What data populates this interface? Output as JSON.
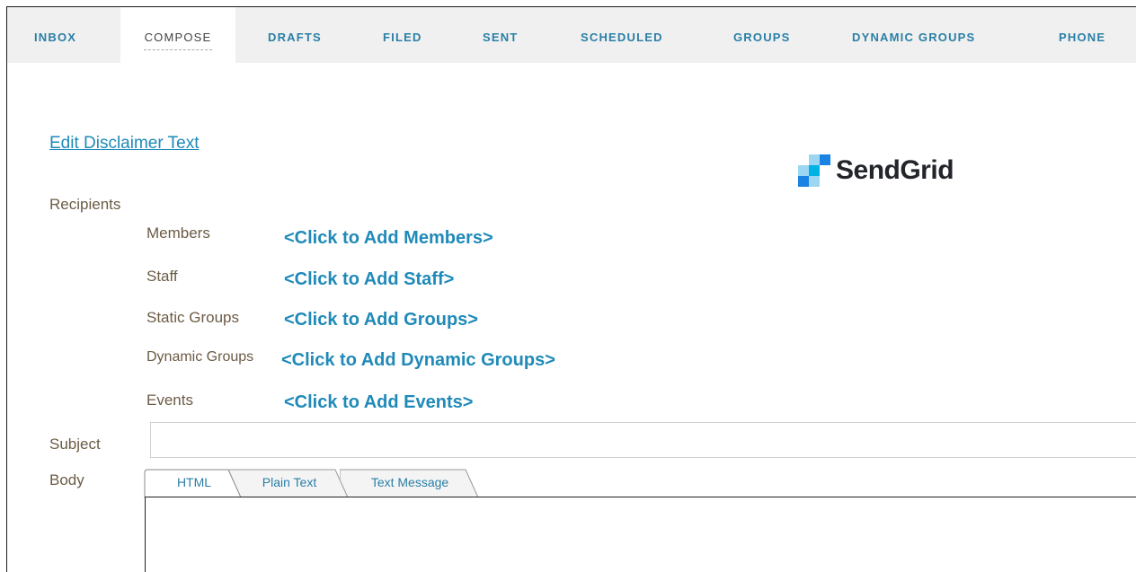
{
  "nav": {
    "items": [
      {
        "label": "INBOX"
      },
      {
        "label": "COMPOSE",
        "active": true
      },
      {
        "label": "DRAFTS"
      },
      {
        "label": "FILED"
      },
      {
        "label": "SENT"
      },
      {
        "label": "SCHEDULED"
      },
      {
        "label": "GROUPS"
      },
      {
        "label": "DYNAMIC GROUPS"
      },
      {
        "label": "PHONE"
      }
    ]
  },
  "compose": {
    "disclaimer_link": "Edit Disclaimer Text",
    "logo_text": "SendGrid",
    "logo_icon": "sendgrid-logo-icon",
    "recipients_label": "Recipients",
    "recipients": [
      {
        "label": "Members",
        "link": "<Click to Add Members>"
      },
      {
        "label": "Staff",
        "link": "<Click to Add Staff>"
      },
      {
        "label": "Static Groups",
        "link": "<Click to Add Groups>"
      },
      {
        "label": "Dynamic Groups",
        "link": "<Click to Add Dynamic Groups>"
      },
      {
        "label": "Events",
        "link": "<Click to Add Events>"
      }
    ],
    "subject_label": "Subject",
    "subject_value": "",
    "body_label": "Body",
    "body_tabs": [
      {
        "label": "HTML",
        "active": true
      },
      {
        "label": "Plain Text"
      },
      {
        "label": "Text Message"
      }
    ]
  },
  "colors": {
    "link": "#1f8ab8",
    "nav_link": "#2a7fa7",
    "label": "#6b5b45",
    "nav_bg": "#f0f0f0"
  }
}
